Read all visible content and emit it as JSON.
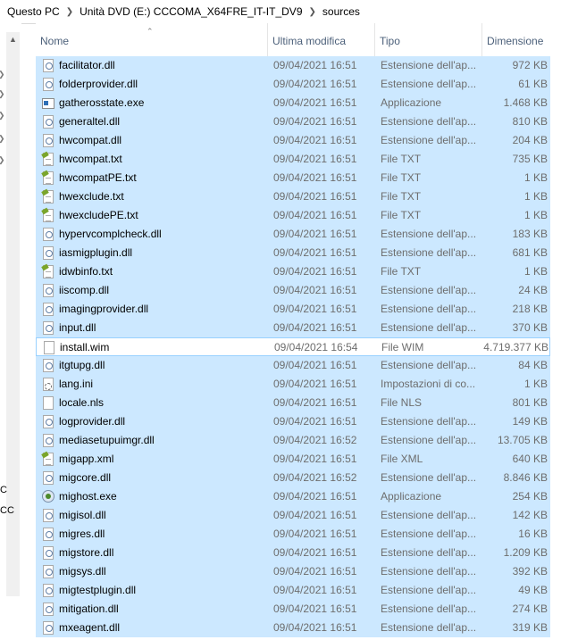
{
  "breadcrumb": [
    "Questo PC",
    "Unità DVD (E:) CCCOMA_X64FRE_IT-IT_DV9",
    "sources"
  ],
  "nav_pane": {
    "fragments": [
      "C",
      "CC"
    ]
  },
  "columns": {
    "name": "Nome",
    "modified": "Ultima modifica",
    "type": "Tipo",
    "size": "Dimensione"
  },
  "files": [
    {
      "name": "facilitator.dll",
      "modified": "09/04/2021 16:51",
      "type": "Estensione dell'ap...",
      "size": "972 KB",
      "icon": "dll-file-icon"
    },
    {
      "name": "folderprovider.dll",
      "modified": "09/04/2021 16:51",
      "type": "Estensione dell'ap...",
      "size": "61 KB",
      "icon": "dll-file-icon"
    },
    {
      "name": "gatherosstate.exe",
      "modified": "09/04/2021 16:51",
      "type": "Applicazione",
      "size": "1.468 KB",
      "icon": "exe-file-icon"
    },
    {
      "name": "generaltel.dll",
      "modified": "09/04/2021 16:51",
      "type": "Estensione dell'ap...",
      "size": "810 KB",
      "icon": "dll-file-icon"
    },
    {
      "name": "hwcompat.dll",
      "modified": "09/04/2021 16:51",
      "type": "Estensione dell'ap...",
      "size": "204 KB",
      "icon": "dll-file-icon"
    },
    {
      "name": "hwcompat.txt",
      "modified": "09/04/2021 16:51",
      "type": "File TXT",
      "size": "735 KB",
      "icon": "txt-file-icon"
    },
    {
      "name": "hwcompatPE.txt",
      "modified": "09/04/2021 16:51",
      "type": "File TXT",
      "size": "1 KB",
      "icon": "txt-file-icon"
    },
    {
      "name": "hwexclude.txt",
      "modified": "09/04/2021 16:51",
      "type": "File TXT",
      "size": "1 KB",
      "icon": "txt-file-icon"
    },
    {
      "name": "hwexcludePE.txt",
      "modified": "09/04/2021 16:51",
      "type": "File TXT",
      "size": "1 KB",
      "icon": "txt-file-icon"
    },
    {
      "name": "hypervcomplcheck.dll",
      "modified": "09/04/2021 16:51",
      "type": "Estensione dell'ap...",
      "size": "183 KB",
      "icon": "dll-file-icon"
    },
    {
      "name": "iasmigplugin.dll",
      "modified": "09/04/2021 16:51",
      "type": "Estensione dell'ap...",
      "size": "681 KB",
      "icon": "dll-file-icon"
    },
    {
      "name": "idwbinfo.txt",
      "modified": "09/04/2021 16:51",
      "type": "File TXT",
      "size": "1 KB",
      "icon": "txt-file-icon"
    },
    {
      "name": "iiscomp.dll",
      "modified": "09/04/2021 16:51",
      "type": "Estensione dell'ap...",
      "size": "24 KB",
      "icon": "dll-file-icon"
    },
    {
      "name": "imagingprovider.dll",
      "modified": "09/04/2021 16:51",
      "type": "Estensione dell'ap...",
      "size": "218 KB",
      "icon": "dll-file-icon"
    },
    {
      "name": "input.dll",
      "modified": "09/04/2021 16:51",
      "type": "Estensione dell'ap...",
      "size": "370 KB",
      "icon": "dll-file-icon"
    },
    {
      "name": "install.wim",
      "modified": "09/04/2021 16:54",
      "type": "File WIM",
      "size": "4.719.377 KB",
      "icon": "file-icon",
      "focused": true
    },
    {
      "name": "itgtupg.dll",
      "modified": "09/04/2021 16:51",
      "type": "Estensione dell'ap...",
      "size": "84 KB",
      "icon": "dll-file-icon"
    },
    {
      "name": "lang.ini",
      "modified": "09/04/2021 16:51",
      "type": "Impostazioni di co...",
      "size": "1 KB",
      "icon": "ini-file-icon"
    },
    {
      "name": "locale.nls",
      "modified": "09/04/2021 16:51",
      "type": "File NLS",
      "size": "801 KB",
      "icon": "file-icon"
    },
    {
      "name": "logprovider.dll",
      "modified": "09/04/2021 16:51",
      "type": "Estensione dell'ap...",
      "size": "149 KB",
      "icon": "dll-file-icon"
    },
    {
      "name": "mediasetupuimgr.dll",
      "modified": "09/04/2021 16:52",
      "type": "Estensione dell'ap...",
      "size": "13.705 KB",
      "icon": "dll-file-icon"
    },
    {
      "name": "migapp.xml",
      "modified": "09/04/2021 16:51",
      "type": "File XML",
      "size": "640 KB",
      "icon": "txt-file-icon"
    },
    {
      "name": "migcore.dll",
      "modified": "09/04/2021 16:52",
      "type": "Estensione dell'ap...",
      "size": "8.846 KB",
      "icon": "dll-file-icon"
    },
    {
      "name": "mighost.exe",
      "modified": "09/04/2021 16:51",
      "type": "Applicazione",
      "size": "254 KB",
      "icon": "setup-exe-icon"
    },
    {
      "name": "migisol.dll",
      "modified": "09/04/2021 16:51",
      "type": "Estensione dell'ap...",
      "size": "142 KB",
      "icon": "dll-file-icon"
    },
    {
      "name": "migres.dll",
      "modified": "09/04/2021 16:51",
      "type": "Estensione dell'ap...",
      "size": "16 KB",
      "icon": "dll-file-icon"
    },
    {
      "name": "migstore.dll",
      "modified": "09/04/2021 16:51",
      "type": "Estensione dell'ap...",
      "size": "1.209 KB",
      "icon": "dll-file-icon"
    },
    {
      "name": "migsys.dll",
      "modified": "09/04/2021 16:51",
      "type": "Estensione dell'ap...",
      "size": "392 KB",
      "icon": "dll-file-icon"
    },
    {
      "name": "migtestplugin.dll",
      "modified": "09/04/2021 16:51",
      "type": "Estensione dell'ap...",
      "size": "49 KB",
      "icon": "dll-file-icon"
    },
    {
      "name": "mitigation.dll",
      "modified": "09/04/2021 16:51",
      "type": "Estensione dell'ap...",
      "size": "274 KB",
      "icon": "dll-file-icon"
    },
    {
      "name": "mxeagent.dll",
      "modified": "09/04/2021 16:51",
      "type": "Estensione dell'ap...",
      "size": "319 KB",
      "icon": "dll-file-icon"
    }
  ],
  "colors": {
    "selection": "#cce8ff",
    "focus_border": "#99d1ff",
    "header_text": "#4c607a"
  }
}
